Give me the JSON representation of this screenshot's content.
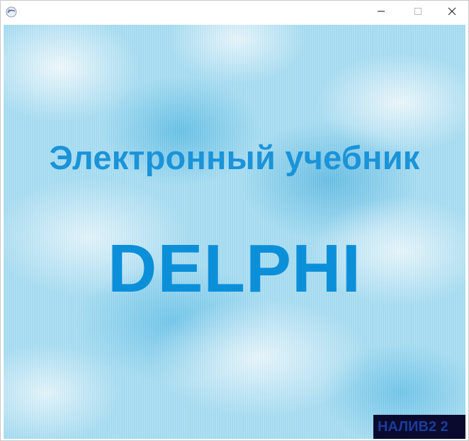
{
  "window": {
    "title_bar_icon": "app-icon",
    "controls": {
      "minimize_icon": "minimize-icon",
      "maximize_icon": "maximize-icon",
      "close_icon": "close-icon"
    }
  },
  "main": {
    "subtitle": "Электронный учебник",
    "title": "DELPHI",
    "author": "НАЛИВ2 2",
    "background_color": "#a9def2",
    "text_color": "#1b93d8"
  }
}
